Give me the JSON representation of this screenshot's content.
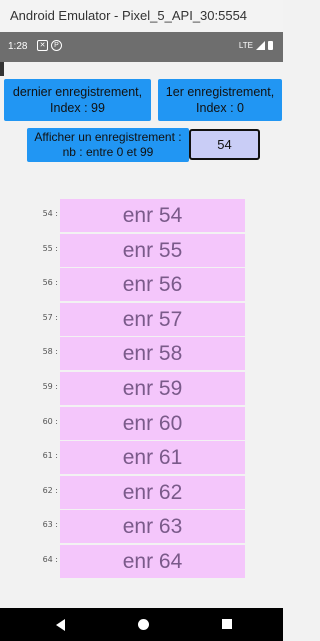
{
  "window": {
    "title": "Android Emulator - Pixel_5_API_30:5554"
  },
  "status": {
    "time": "1:28",
    "network": "LTE"
  },
  "buttons": {
    "last_record_line1": "dernier enregistrement,",
    "last_record_line2": "Index : 99",
    "first_record_line1": "1er enregistrement,",
    "first_record_line2": "Index : 0",
    "show_line1": "Afficher un enregistrement :",
    "show_line2": "nb : entre 0 et 99"
  },
  "record_input": {
    "value": "54"
  },
  "records": [
    {
      "index": "54 :",
      "label": "enr 54"
    },
    {
      "index": "55 :",
      "label": "enr 55"
    },
    {
      "index": "56 :",
      "label": "enr 56"
    },
    {
      "index": "57 :",
      "label": "enr 57"
    },
    {
      "index": "58 :",
      "label": "enr 58"
    },
    {
      "index": "59 :",
      "label": "enr 59"
    },
    {
      "index": "60 :",
      "label": "enr 60"
    },
    {
      "index": "61 :",
      "label": "enr 61"
    },
    {
      "index": "62 :",
      "label": "enr 62"
    },
    {
      "index": "63 :",
      "label": "enr 63"
    },
    {
      "index": "64 :",
      "label": "enr 64"
    }
  ]
}
